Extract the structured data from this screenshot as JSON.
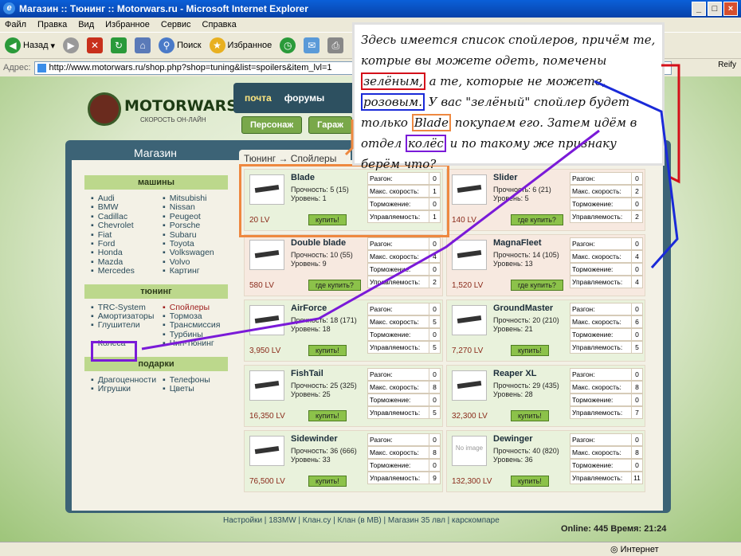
{
  "window": {
    "title": "Магазин :: Тюнинг :: Motorwars.ru - Microsoft Internet Explorer"
  },
  "menu": [
    "Файл",
    "Правка",
    "Вид",
    "Избранное",
    "Сервис",
    "Справка"
  ],
  "toolbar": {
    "back": "Назад",
    "search": "Поиск",
    "favorites": "Избранное"
  },
  "address": {
    "label": "Адрес:",
    "url": "http://www.motorwars.ru/shop.php?shop=tuning&list=spoilers&item_lvl=1"
  },
  "reify": "Reify",
  "site": {
    "logo": "MOTORWARS.RU",
    "tagline": "СКОРОСТЬ ОН-ЛАЙН",
    "nav": [
      "почта",
      "форумы"
    ],
    "nav2": [
      "Персонаж",
      "Гараж"
    ]
  },
  "shop": {
    "title": "Магазин",
    "crumb": "Тюнинг  →  Спойлеры"
  },
  "sidebar": {
    "machines": {
      "title": "машины",
      "left": [
        "Audi",
        "BMW",
        "Cadillac",
        "Chevrolet",
        "Fiat",
        "Ford",
        "Honda",
        "Mazda",
        "Mercedes"
      ],
      "right": [
        "Mitsubishi",
        "Nissan",
        "Peugeot",
        "Porsche",
        "Subaru",
        "Toyota",
        "Volkswagen",
        "Volvo",
        "Картинг"
      ]
    },
    "tuning": {
      "title": "тюнинг",
      "left": [
        "TRC-System",
        "Амортизаторы",
        "Глушители",
        "",
        "Колеса"
      ],
      "right": [
        "Спойлеры",
        "Тормоза",
        "Трансмиссия",
        "Турбины",
        "Чип-тюнинг"
      ]
    },
    "gifts": {
      "title": "подарки",
      "left": [
        "Драгоценности",
        "Игрушки"
      ],
      "right": [
        "Телефоны",
        "Цветы"
      ]
    }
  },
  "stat_labels": [
    "Разгон:",
    "Макс. скорость:",
    "Торможение:",
    "Управляемость:"
  ],
  "items": [
    {
      "name": "Blade",
      "durability": "Прочность: 5 (15)",
      "level": "Уровень: 1",
      "price": "20 LV",
      "buy": "купить!",
      "stats": [
        "0",
        "1",
        "0",
        "1"
      ],
      "can_buy": true
    },
    {
      "name": "Slider",
      "durability": "Прочность: 6 (21)",
      "level": "Уровень: 5",
      "price": "140 LV",
      "buy": "где купить?",
      "stats": [
        "0",
        "2",
        "0",
        "2"
      ],
      "can_buy": false
    },
    {
      "name": "Double blade",
      "durability": "Прочность: 10 (55)",
      "level": "Уровень: 9",
      "price": "580 LV",
      "buy": "где купить?",
      "stats": [
        "0",
        "4",
        "0",
        "2"
      ],
      "can_buy": false
    },
    {
      "name": "MagnaFleet",
      "durability": "Прочность: 14 (105)",
      "level": "Уровень: 13",
      "price": "1,520 LV",
      "buy": "где купить?",
      "stats": [
        "0",
        "4",
        "0",
        "4"
      ],
      "can_buy": false
    },
    {
      "name": "AirForce",
      "durability": "Прочность: 18 (171)",
      "level": "Уровень: 18",
      "price": "3,950 LV",
      "buy": "купить!",
      "stats": [
        "0",
        "5",
        "0",
        "5"
      ],
      "can_buy": true
    },
    {
      "name": "GroundMaster",
      "durability": "Прочность: 20 (210)",
      "level": "Уровень: 21",
      "price": "7,270 LV",
      "buy": "купить!",
      "stats": [
        "0",
        "6",
        "0",
        "5"
      ],
      "can_buy": true
    },
    {
      "name": "FishTail",
      "durability": "Прочность: 25 (325)",
      "level": "Уровень: 25",
      "price": "16,350 LV",
      "buy": "купить!",
      "stats": [
        "0",
        "8",
        "0",
        "5"
      ],
      "can_buy": true
    },
    {
      "name": "Reaper XL",
      "durability": "Прочность: 29 (435)",
      "level": "Уровень: 28",
      "price": "32,300 LV",
      "buy": "купить!",
      "stats": [
        "0",
        "8",
        "0",
        "7"
      ],
      "can_buy": true
    },
    {
      "name": "Sidewinder",
      "durability": "Прочность: 36 (666)",
      "level": "Уровень: 33",
      "price": "76,500 LV",
      "buy": "купить!",
      "stats": [
        "0",
        "8",
        "0",
        "9"
      ],
      "can_buy": true
    },
    {
      "name": "Dewinger",
      "durability": "Прочность: 40 (820)",
      "level": "Уровень: 36",
      "price": "132,300 LV",
      "buy": "купить!",
      "stats": [
        "0",
        "8",
        "0",
        "11"
      ],
      "can_buy": true,
      "noimg": "No image"
    }
  ],
  "footer": {
    "links": "Настройки | 183MW | Клан.су | Клан (в МВ) | Магазин 35 лвл | карскомпаре",
    "online": "Online: 445  Время: 21:24"
  },
  "status": {
    "zone": "Интернет"
  },
  "annotation": {
    "p1": "Здесь имеется список спойлеров, причём те, котрые вы можете одеть, помечены ",
    "green": "зелёным,",
    "p2": " а те, которые не можете, ",
    "pink": "розовым.",
    "p3": " У вас \"зелёный\" спойлер будет только ",
    "blade": "Blade",
    "p4": " покупаем его. Затем идём в отдел ",
    "wheels": "колёс",
    "p5": " и по такому же признаку берём что?"
  },
  "colors": {
    "green": "#d4101a",
    "pink": "#1a2ad8",
    "orange": "#ee8840",
    "purple": "#7a1ad8"
  }
}
